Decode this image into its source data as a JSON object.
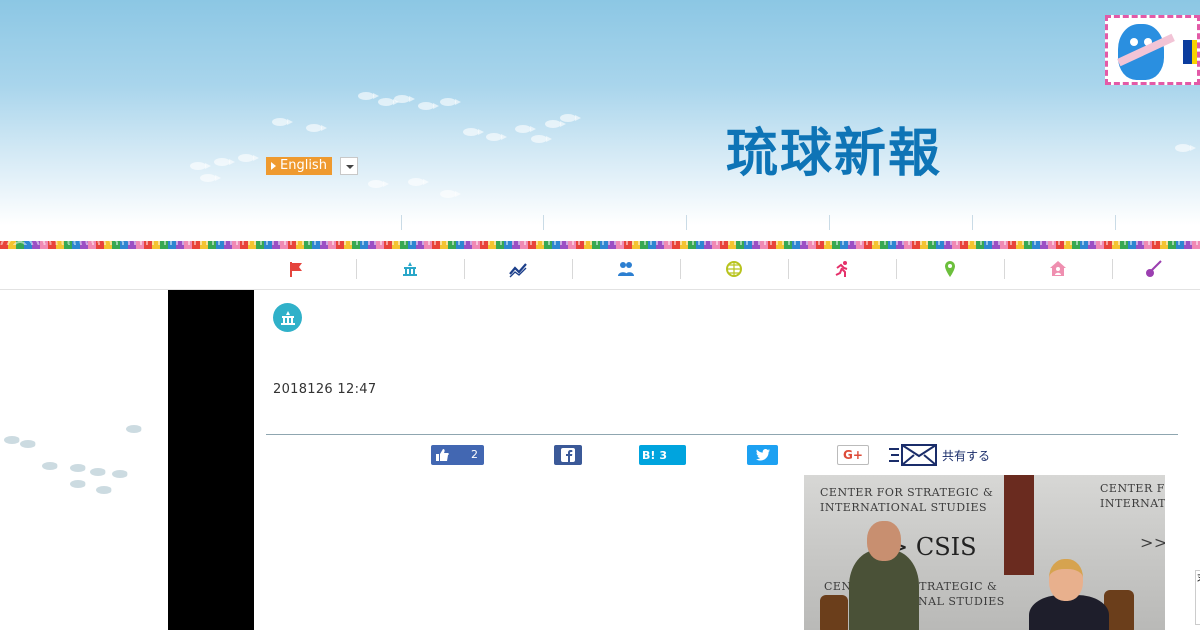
{
  "header": {
    "logo_text": "琉球新報",
    "language_button": "English"
  },
  "category_nav": [
    {
      "icon": "flag-icon",
      "color": "#e5443d"
    },
    {
      "icon": "parliament-icon",
      "color": "#2aa7c9"
    },
    {
      "icon": "chart-line-icon",
      "color": "#1b3e8a"
    },
    {
      "icon": "people-icon",
      "color": "#2c7fd1"
    },
    {
      "icon": "globe-icon",
      "color": "#b8c31e"
    },
    {
      "icon": "runner-icon",
      "color": "#e5306a"
    },
    {
      "icon": "map-pin-icon",
      "color": "#6cbf3c"
    },
    {
      "icon": "home-icon",
      "color": "#ef8fb0"
    },
    {
      "icon": "sanshin-icon",
      "color": "#9b3fb0"
    }
  ],
  "article": {
    "category_color": "#30b1c9",
    "date": "2018126 12:47"
  },
  "share": {
    "fb_like_count": "2",
    "hatena_label": "B!",
    "hatena_count": "3",
    "googleplus_label": "G+",
    "share_label": "共有する"
  },
  "photo": {
    "text_line1": "CENTER FOR STRATEGIC &",
    "text_line2": "INTERNATIONAL STUDIES",
    "text_csis": ">> CSIS",
    "text_right1": "CENTER FO",
    "text_right2": "INTERNATIO",
    "text_right3": ">>",
    "text_lower1": "CENTER FOR STRATEGIC &",
    "text_lower2": "ATIONAL STUDIES"
  },
  "edge_char": "ヌ"
}
